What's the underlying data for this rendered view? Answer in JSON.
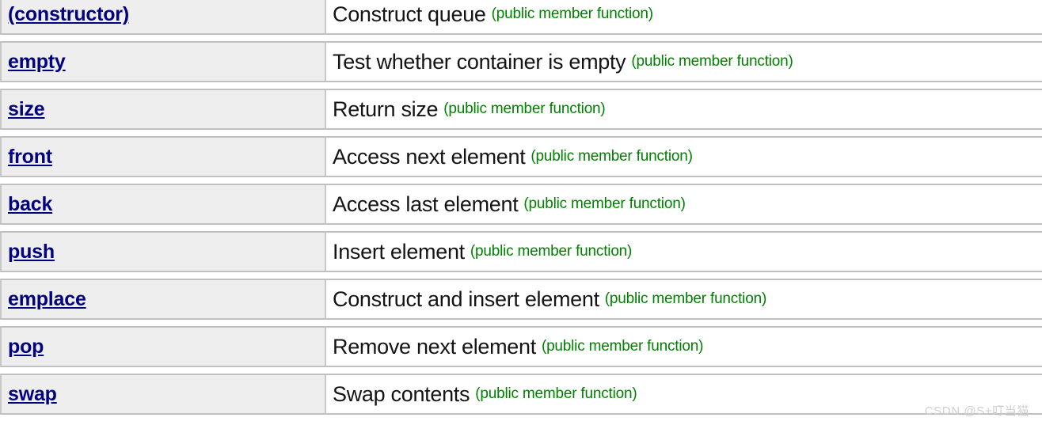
{
  "reference_table": {
    "name_column_header": "",
    "description_column_header": "",
    "rows": [
      {
        "name": "(constructor)",
        "description": "Construct queue",
        "note": "(public member function)"
      },
      {
        "name": "empty",
        "description": "Test whether container is empty",
        "note": "(public member function)"
      },
      {
        "name": "size",
        "description": "Return size",
        "note": "(public member function)"
      },
      {
        "name": "front",
        "description": "Access next element",
        "note": "(public member function)"
      },
      {
        "name": "back",
        "description": "Access last element",
        "note": "(public member function)"
      },
      {
        "name": "push",
        "description": "Insert element",
        "note": "(public member function)"
      },
      {
        "name": "emplace",
        "description": "Construct and insert element",
        "note": "(public member function)"
      },
      {
        "name": "pop",
        "description": "Remove next element",
        "note": "(public member function)"
      },
      {
        "name": "swap",
        "description": "Swap contents",
        "note": "(public member function)"
      }
    ]
  },
  "watermark": {
    "text": "CSDN @S+叮当猫"
  },
  "colors": {
    "link": "#000080",
    "note": "#008000",
    "name_cell_background": "#eeeeee",
    "row_border": "#c0c0c0",
    "page_background": "#ffffff",
    "watermark": "#cfcfcf"
  }
}
